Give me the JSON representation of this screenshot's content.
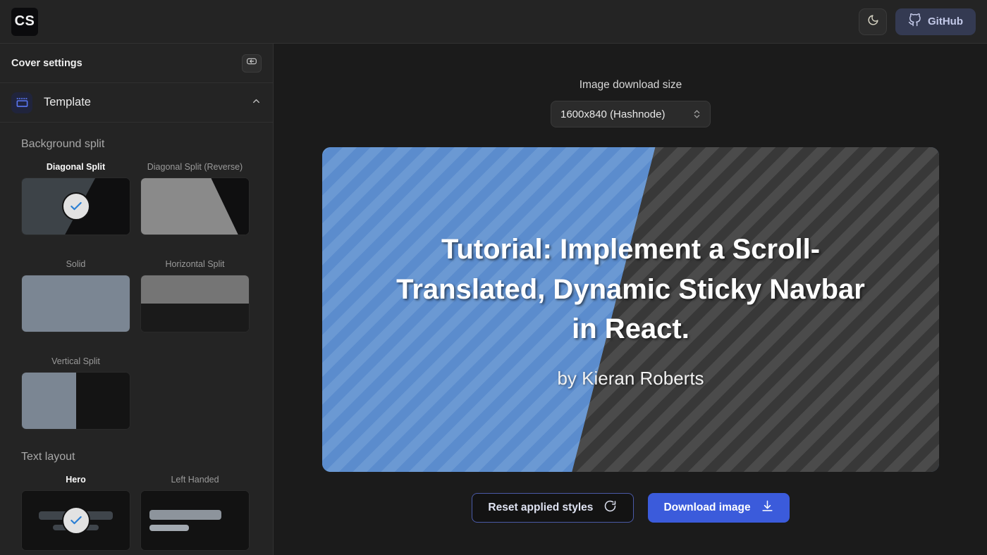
{
  "topbar": {
    "logo_text": "CS",
    "theme_toggle_icon": "moon-icon",
    "github_label": "GitHub",
    "github_icon": "github-icon"
  },
  "sidebar": {
    "title": "Cover settings",
    "collapse_icon": "collapse-sidebar-icon",
    "section": {
      "label": "Template",
      "icon": "template-layout-icon",
      "chevron": "chevron-up-icon",
      "expanded": true
    },
    "groups": [
      {
        "title": "Background split",
        "options": [
          {
            "label": "Diagonal Split",
            "variant": "v-diag",
            "selected": true
          },
          {
            "label": "Diagonal Split (Reverse)",
            "variant": "v-diagrev",
            "selected": false
          },
          {
            "label": "Solid",
            "variant": "v-solid",
            "selected": false
          },
          {
            "label": "Horizontal Split",
            "variant": "v-hsplit",
            "selected": false
          },
          {
            "label": "Vertical Split",
            "variant": "v-vsplit",
            "selected": false
          }
        ]
      },
      {
        "title": "Text layout",
        "options": [
          {
            "label": "Hero",
            "variant": "v-hero",
            "selected": true
          },
          {
            "label": "Left Handed",
            "variant": "v-left",
            "selected": false
          }
        ]
      }
    ]
  },
  "main": {
    "size_label": "Image download size",
    "size_value": "1600x840 (Hashnode)",
    "size_options": [
      "1600x840 (Hashnode)"
    ],
    "stepper_icon": "chevron-up-down-icon",
    "cover": {
      "title": "Tutorial: Implement a Scroll-Translated, Dynamic Sticky Navbar in React.",
      "author": "by Kieran Roberts",
      "left_color": "#5b8ccd",
      "left_stripe_color": "#6b99d3",
      "right_color": "#383838",
      "right_stripe_color": "#4b4b4b",
      "pattern": "diagonal-stripes"
    },
    "reset_label": "Reset applied styles",
    "reset_icon": "refresh-icon",
    "download_label": "Download image",
    "download_icon": "download-arrow-icon"
  },
  "colors": {
    "accent": "#3b5bdb",
    "accent_muted": "#343a52",
    "sidebar_bg": "#242424",
    "main_bg": "#1b1b1b",
    "check_blue": "#2b7fd4"
  }
}
